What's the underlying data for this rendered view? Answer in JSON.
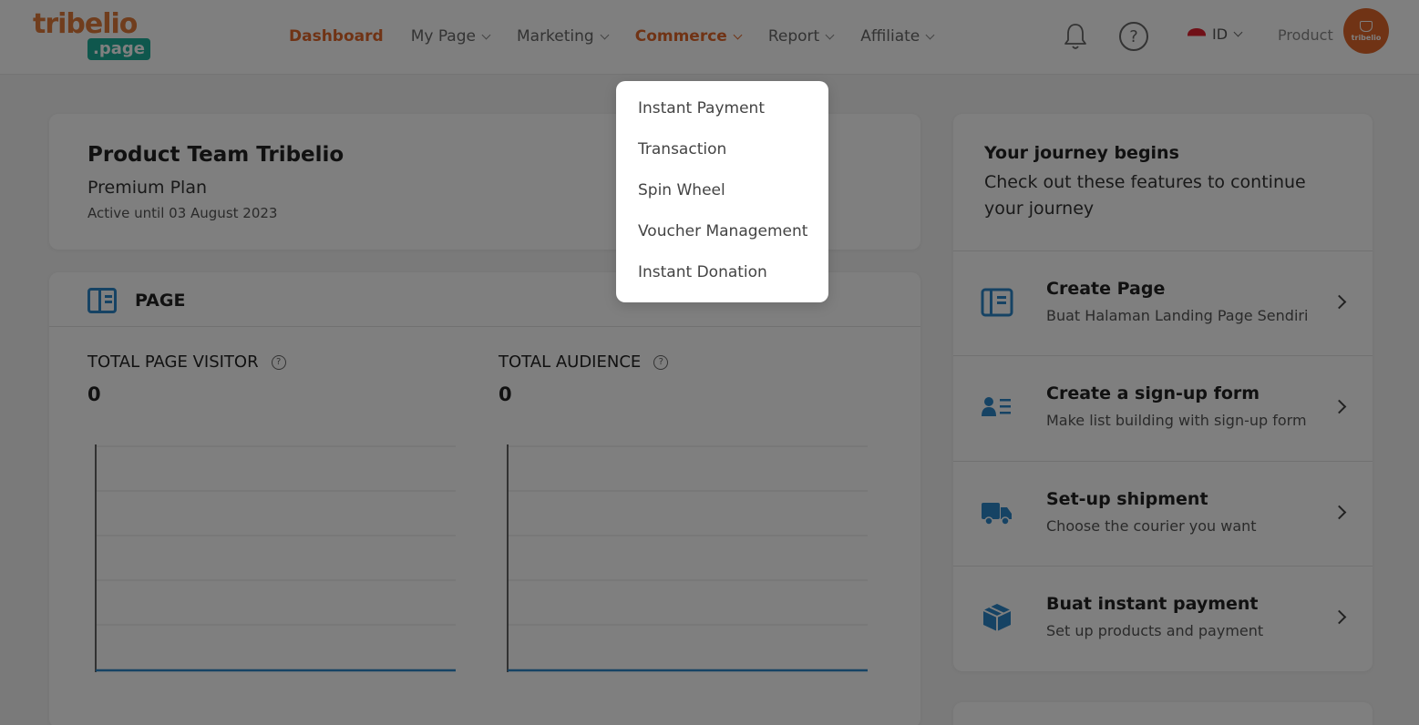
{
  "header": {
    "logo_top": "tribelio",
    "logo_bottom": ".page",
    "nav": [
      {
        "label": "Dashboard",
        "state": "active",
        "has_caret": false
      },
      {
        "label": "My Page",
        "state": "",
        "has_caret": true
      },
      {
        "label": "Marketing",
        "state": "",
        "has_caret": true
      },
      {
        "label": "Commerce",
        "state": "open",
        "has_caret": true
      },
      {
        "label": "Report",
        "state": "",
        "has_caret": true
      },
      {
        "label": "Affiliate",
        "state": "",
        "has_caret": true
      }
    ],
    "help_glyph": "?",
    "language": "ID",
    "user_name": "Product",
    "avatar_text": "tribelio",
    "icons": {
      "bell": "bell-icon",
      "help": "help-icon",
      "flag": "indonesia-flag-icon"
    }
  },
  "profile": {
    "name": "Product Team Tribelio",
    "plan": "Premium Plan",
    "active_until": "Active until 03 August 2023"
  },
  "page_section": {
    "title": "PAGE",
    "metrics": [
      {
        "label": "TOTAL PAGE VISITOR",
        "value": "0"
      },
      {
        "label": "TOTAL AUDIENCE",
        "value": "0"
      }
    ]
  },
  "journey": {
    "title": "Your journey begins",
    "subtitle": "Check out these features to continue your journey",
    "items": [
      {
        "title": "Create Page",
        "subtitle": "Buat Halaman Landing Page Sendiri",
        "icon": "page-layout-icon"
      },
      {
        "title": "Create a sign-up form",
        "subtitle": "Make list building with sign-up form",
        "icon": "contact-list-icon"
      },
      {
        "title": "Set-up shipment",
        "subtitle": "Choose the courier you want",
        "icon": "truck-icon"
      },
      {
        "title": "Buat instant payment",
        "subtitle": "Set up products and payment",
        "icon": "box-icon"
      }
    ]
  },
  "commerce_menu": {
    "items": [
      "Instant Payment",
      "Transaction",
      "Spin Wheel",
      "Voucher Management"
    ],
    "highlighted": "Instant Donation"
  },
  "colors": {
    "brand_orange": "#e0672a",
    "brand_teal": "#1fae9a",
    "icon_blue": "#2d87c8",
    "overlay": "rgba(0,0,0,0.5)"
  }
}
